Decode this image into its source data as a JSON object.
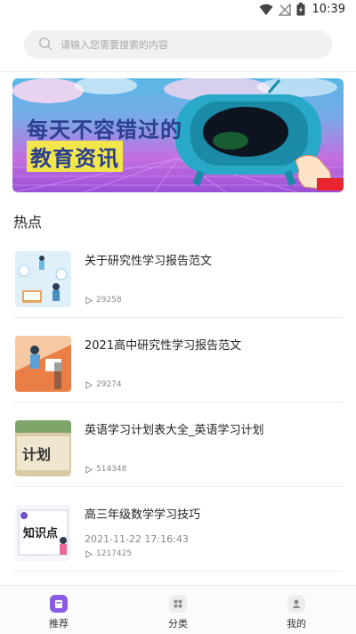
{
  "status_bar": {
    "time": "10:39"
  },
  "search": {
    "placeholder": "请输入您需要搜索的内容"
  },
  "banner": {
    "line1": "每天不容错过的",
    "line2": "教育资讯"
  },
  "section": {
    "title": "热点"
  },
  "articles": [
    {
      "title": "关于研究性学习报告范文",
      "views": "29258"
    },
    {
      "title": "2021高中研究性学习报告范文",
      "views": "29274"
    },
    {
      "title": "英语学习计划表大全_英语学习计划",
      "views": "514348",
      "thumb_text": "计划"
    },
    {
      "title": "高三年级数学学习技巧",
      "date": "2021-11-22 17:16:43",
      "views": "1217425",
      "thumb_text": "知识点"
    }
  ],
  "tabbar": {
    "tabs": [
      {
        "label": "推荐",
        "icon": "home-icon",
        "active": true
      },
      {
        "label": "分类",
        "icon": "grid-icon",
        "active": false
      },
      {
        "label": "我的",
        "icon": "user-icon",
        "active": false
      }
    ]
  },
  "colors": {
    "accent": "#8a5ce6",
    "banner_text": "#2b3f8f"
  }
}
